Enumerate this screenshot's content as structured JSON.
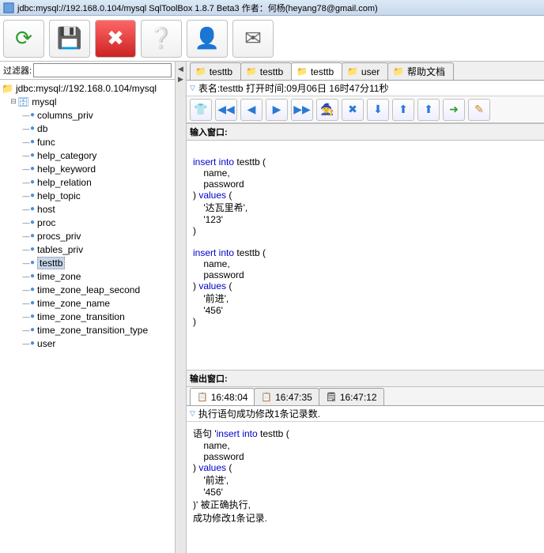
{
  "window": {
    "title": "jdbc:mysql://192.168.0.104/mysql SqlToolBox 1.8.7 Beta3  作者：何杨(heyang78@gmail.com)"
  },
  "toolbar": {
    "refresh": "↻",
    "save": "💾",
    "close": "✖",
    "help": "?",
    "user": "👤",
    "mail": "✉"
  },
  "filter": {
    "label": "过滤器:",
    "value": ""
  },
  "tree": {
    "root": "jdbc:mysql://192.168.0.104/mysql",
    "db": "mysql",
    "items": [
      "columns_priv",
      "db",
      "func",
      "help_category",
      "help_keyword",
      "help_relation",
      "help_topic",
      "host",
      "proc",
      "procs_priv",
      "tables_priv",
      "testtb",
      "time_zone",
      "time_zone_leap_second",
      "time_zone_name",
      "time_zone_transition",
      "time_zone_transition_type",
      "user"
    ],
    "selected": "testtb"
  },
  "tabs": [
    {
      "label": "testtb",
      "active": false
    },
    {
      "label": "testtb",
      "active": false
    },
    {
      "label": "testtb",
      "active": true
    },
    {
      "label": "user",
      "active": false
    },
    {
      "label": "帮助文档",
      "active": false
    }
  ],
  "table_info": "表名:testtb  打开时间:09月06日 16时47分11秒",
  "input_header": "输入窗口:",
  "sql_input_lines": [
    {
      "t": "",
      "k": false
    },
    {
      "t": "insert into",
      "k": true,
      "rest": " testtb ("
    },
    {
      "t": "    name,",
      "k": false
    },
    {
      "t": "    password",
      "k": false
    },
    {
      "t": ") ",
      "k": false,
      "kw2": "values",
      "rest2": " ("
    },
    {
      "t": "    '达瓦里希',",
      "k": false
    },
    {
      "t": "    '123'",
      "k": false
    },
    {
      "t": ")",
      "k": false
    },
    {
      "t": "",
      "k": false
    },
    {
      "t": "insert into",
      "k": true,
      "rest": " testtb ("
    },
    {
      "t": "    name,",
      "k": false
    },
    {
      "t": "    password",
      "k": false
    },
    {
      "t": ") ",
      "k": false,
      "kw2": "values",
      "rest2": " ("
    },
    {
      "t": "    '前进',",
      "k": false
    },
    {
      "t": "    '456'",
      "k": false
    },
    {
      "t": ")",
      "k": false
    }
  ],
  "output_header": "输出窗口:",
  "out_tabs": [
    {
      "label": "16:48:04",
      "icon": "📋",
      "active": true
    },
    {
      "label": "16:47:35",
      "icon": "📋",
      "active": false
    },
    {
      "label": "16:47:12",
      "icon": "🗒",
      "active": false
    }
  ],
  "exec_status": "执行语句成功修改1条记录数.",
  "sql_output_lines": [
    {
      "pre": "语句 '",
      "kw": "insert into",
      "rest": " testtb ("
    },
    {
      "t": "    name,"
    },
    {
      "t": "    password"
    },
    {
      "pre": ") ",
      "kw": "values",
      "rest": " ("
    },
    {
      "t": "    '前进',"
    },
    {
      "t": "    '456'"
    },
    {
      "t": ")' 被正确执行,"
    },
    {
      "t": "成功修改1条记录."
    }
  ]
}
